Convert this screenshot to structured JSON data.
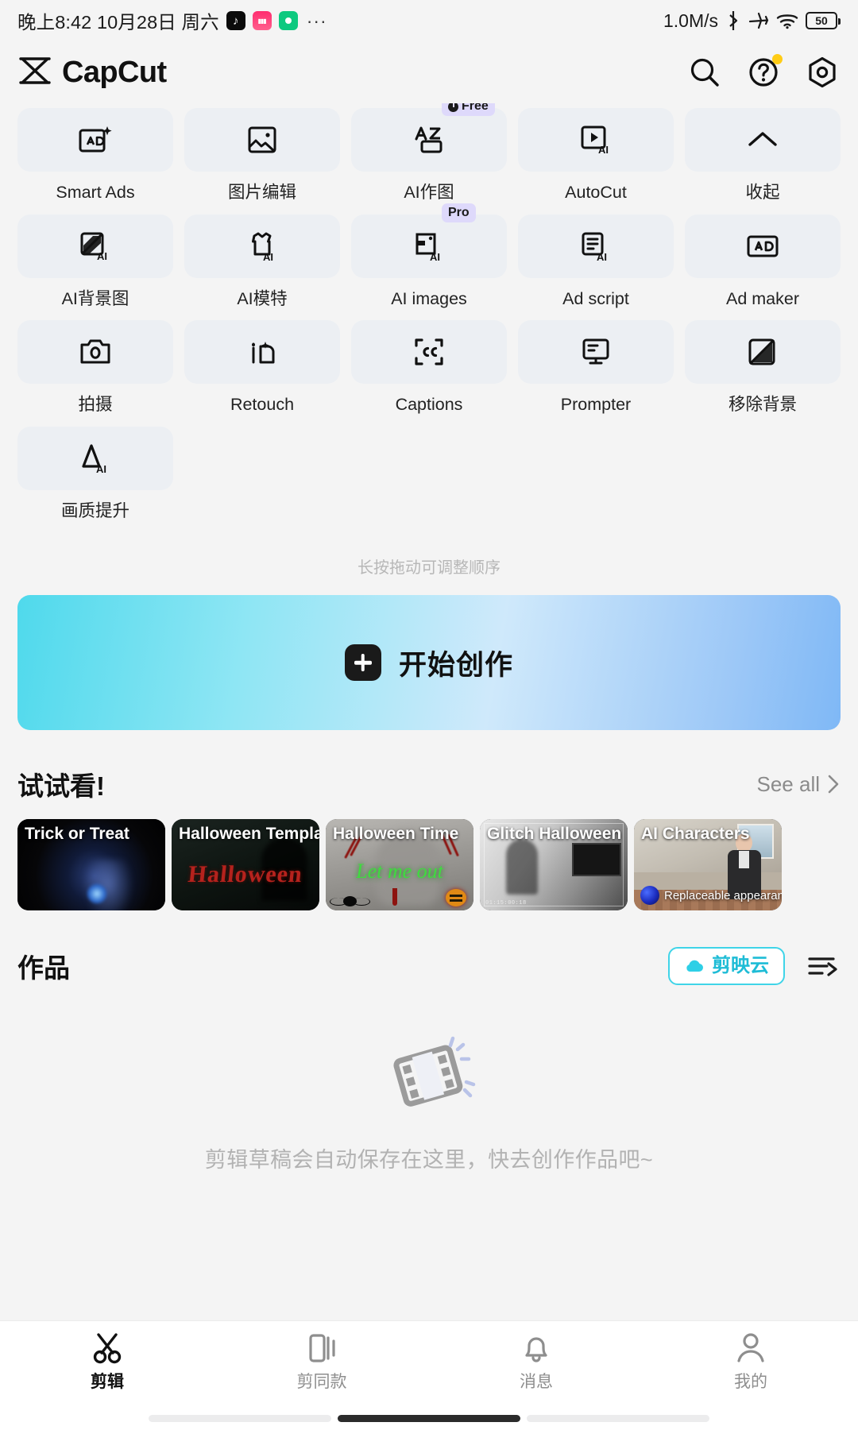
{
  "statusbar": {
    "time": "晚上8:42 10月28日 周六",
    "app_icons": [
      "tiktok-icon",
      "pink-app-icon",
      "green-app-icon"
    ],
    "overflow": "···",
    "network_speed": "1.0M/s",
    "indicators": [
      "bluetooth-icon",
      "airplane-icon",
      "wifi-icon"
    ],
    "battery_level": "50"
  },
  "header": {
    "brand": "CapCut",
    "actions": [
      {
        "name": "search-icon",
        "label": "Search"
      },
      {
        "name": "help-icon",
        "label": "Help",
        "badge": true
      },
      {
        "name": "settings-icon",
        "label": "Settings"
      }
    ]
  },
  "tools": {
    "hint": "长按拖动可调整顺序",
    "items": [
      {
        "label": "Smart Ads",
        "icon": "smart-ads-icon",
        "badge": null
      },
      {
        "label": "图片编辑",
        "icon": "image-edit-icon",
        "badge": null
      },
      {
        "label": "AI作图",
        "icon": "ai-drawing-icon",
        "badge": "Free"
      },
      {
        "label": "AutoCut",
        "icon": "autocut-icon",
        "badge": null
      },
      {
        "label": "收起",
        "icon": "collapse-chevron-icon",
        "badge": null
      },
      {
        "label": "AI背景图",
        "icon": "ai-background-icon",
        "badge": null
      },
      {
        "label": "AI模特",
        "icon": "ai-model-icon",
        "badge": null
      },
      {
        "label": "AI images",
        "icon": "ai-images-icon",
        "badge": "Pro"
      },
      {
        "label": "Ad script",
        "icon": "ad-script-icon",
        "badge": null
      },
      {
        "label": "Ad maker",
        "icon": "ad-maker-icon",
        "badge": null
      },
      {
        "label": "拍摄",
        "icon": "camera-icon",
        "badge": null
      },
      {
        "label": "Retouch",
        "icon": "retouch-icon",
        "badge": null
      },
      {
        "label": "Captions",
        "icon": "captions-icon",
        "badge": null
      },
      {
        "label": "Prompter",
        "icon": "prompter-icon",
        "badge": null
      },
      {
        "label": "移除背景",
        "icon": "remove-background-icon",
        "badge": null
      },
      {
        "label": "画质提升",
        "icon": "enhance-quality-icon",
        "badge": null
      }
    ]
  },
  "create": {
    "label": "开始创作",
    "icon": "plus-icon"
  },
  "try_section": {
    "title": "试试看!",
    "see_all": "See all",
    "cards": [
      {
        "title": "Trick or Treat"
      },
      {
        "title": "Halloween Templates",
        "art_text": "Halloween"
      },
      {
        "title": "Halloween Time",
        "art_text": "Let me out"
      },
      {
        "title": "Glitch Halloween",
        "timecode": "01:15:00:18"
      },
      {
        "title": "AI Characters",
        "caption": "Replaceable appearance"
      }
    ]
  },
  "works": {
    "title": "作品",
    "cloud_label": "剪映云",
    "sort_icon": "sort-list-icon",
    "empty_text": "剪辑草稿会自动保存在这里，快去创作作品吧~",
    "empty_icon": "film-strip-icon"
  },
  "tabbar": {
    "items": [
      {
        "label": "剪辑",
        "icon": "scissors-icon",
        "active": true
      },
      {
        "label": "剪同款",
        "icon": "templates-icon",
        "active": false
      },
      {
        "label": "消息",
        "icon": "bell-icon",
        "active": false
      },
      {
        "label": "我的",
        "icon": "person-icon",
        "active": false
      }
    ]
  },
  "colors": {
    "accent_cyan": "#1fbcd6",
    "badge_purple": "#ded9fb",
    "tile_bg": "#eceff3",
    "page_bg": "#f4f4f4"
  }
}
